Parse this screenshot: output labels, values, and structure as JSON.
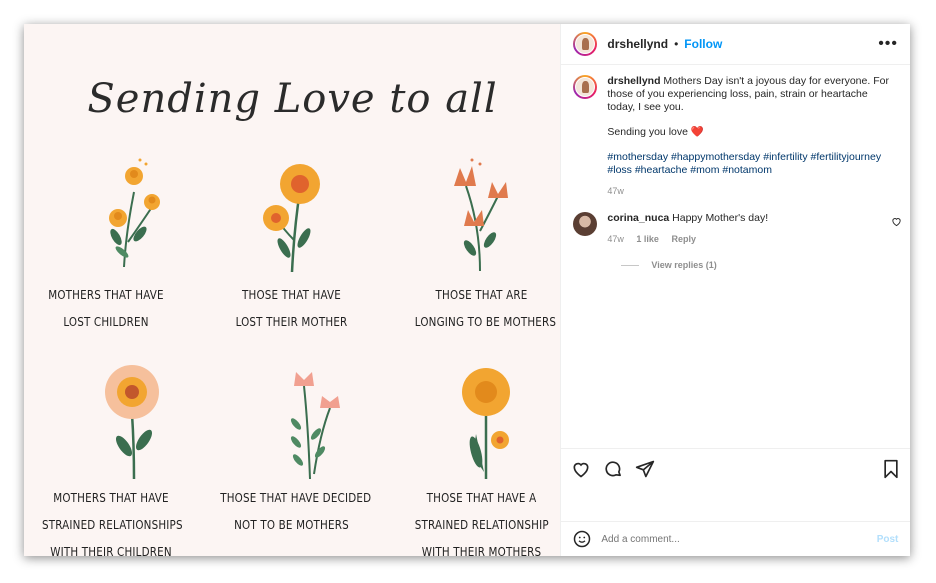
{
  "post_image": {
    "headline": "Sending Love to all",
    "captions": [
      [
        "MOTHERS THAT HAVE",
        "LOST CHILDREN"
      ],
      [
        "THOSE THAT HAVE",
        "LOST THEIR MOTHER"
      ],
      [
        "THOSE THAT ARE",
        "LONGING TO BE MOTHERS"
      ],
      [
        "MOTHERS THAT HAVE",
        "STRAINED RELATIONSHIPS",
        "WITH THEIR CHILDREN"
      ],
      [
        "THOSE THAT HAVE DECIDED",
        "NOT TO BE MOTHERS"
      ],
      [
        "THOSE THAT HAVE A",
        "STRAINED RELATIONSHIP",
        "WITH THEIR MOTHERS"
      ]
    ]
  },
  "header": {
    "username": "drshellynd",
    "separator": "•",
    "follow_label": "Follow",
    "more_icon": "•••"
  },
  "caption": {
    "username": "drshellynd",
    "text": "Mothers Day isn't a joyous day for everyone. For those of you experiencing loss, pain, strain or heartache today, I see you.",
    "love_line": "Sending you love ❤️",
    "hashtags": "#mothersday #happymothersday #infertility #fertilityjourney #loss #heartache #mom #notamom",
    "age": "47w"
  },
  "comment": {
    "username": "corina_nuca",
    "text": "Happy Mother's day!",
    "age": "47w",
    "likes": "1 like",
    "reply_label": "Reply",
    "view_replies": "View replies (1)"
  },
  "add_comment": {
    "placeholder": "Add a comment...",
    "post_label": "Post"
  },
  "colors": {
    "accent": "#0095f6",
    "hashtag": "#00376b",
    "image_bg": "#fcf5f3"
  }
}
